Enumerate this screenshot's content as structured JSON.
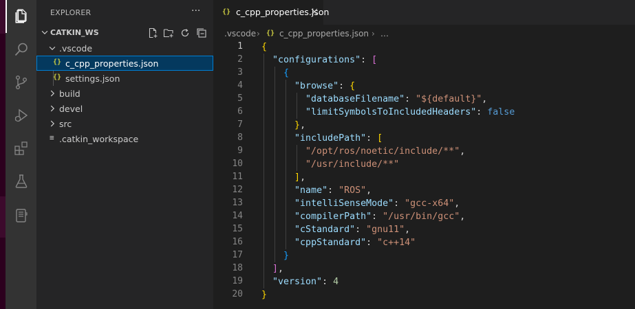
{
  "sidebar": {
    "title": "EXPLORER",
    "more": "···",
    "workspace": "CATKIN_WS",
    "actions": [
      "new-file-icon",
      "new-folder-icon",
      "refresh-icon",
      "collapse-all-icon"
    ],
    "tree": [
      {
        "label": ".vscode",
        "kind": "folder",
        "expanded": true
      },
      {
        "label": "c_cpp_properties.json",
        "kind": "json",
        "selected": true
      },
      {
        "label": "settings.json",
        "kind": "json"
      },
      {
        "label": "build",
        "kind": "folder",
        "expanded": false
      },
      {
        "label": "devel",
        "kind": "folder",
        "expanded": false
      },
      {
        "label": "src",
        "kind": "folder",
        "expanded": false
      },
      {
        "label": ".catkin_workspace",
        "kind": "file"
      }
    ]
  },
  "activity": [
    "files-icon",
    "search-icon",
    "source-control-icon",
    "run-debug-icon",
    "extensions-icon",
    "testing-icon",
    "notebook-icon"
  ],
  "editor": {
    "tab": {
      "label": "c_cpp_properties.json",
      "icon": "{}"
    },
    "breadcrumb": {
      "folder": ".vscode",
      "file": "c_cpp_properties.json",
      "more": "…"
    },
    "line_numbers": [
      "1",
      "2",
      "3",
      "4",
      "5",
      "6",
      "7",
      "8",
      "9",
      "10",
      "11",
      "12",
      "13",
      "14",
      "15",
      "16",
      "17",
      "18",
      "19",
      "20"
    ],
    "code": {
      "k_configurations": "\"configurations\"",
      "k_browse": "\"browse\"",
      "k_databaseFilename": "\"databaseFilename\"",
      "v_databaseFilename": "\"${default}\"",
      "k_limitSymbols": "\"limitSymbolsToIncludedHeaders\"",
      "v_limitSymbols": "false",
      "k_includePath": "\"includePath\"",
      "v_include_1": "\"/opt/ros/noetic/include/**\"",
      "v_include_2": "\"/usr/include/**\"",
      "k_name": "\"name\"",
      "v_name": "\"ROS\"",
      "k_intelliSenseMode": "\"intelliSenseMode\"",
      "v_intelliSenseMode": "\"gcc-x64\"",
      "k_compilerPath": "\"compilerPath\"",
      "v_compilerPath": "\"/usr/bin/gcc\"",
      "k_cStandard": "\"cStandard\"",
      "v_cStandard": "\"gnu11\"",
      "k_cppStandard": "\"cppStandard\"",
      "v_cppStandard": "\"c++14\"",
      "k_version": "\"version\"",
      "v_version": "4"
    }
  },
  "colors": {
    "activity_bar": "#333333",
    "sidebar": "#252526",
    "editor": "#1e1e1e",
    "selection": "#04395e",
    "json_icon": "#cbcb41"
  }
}
